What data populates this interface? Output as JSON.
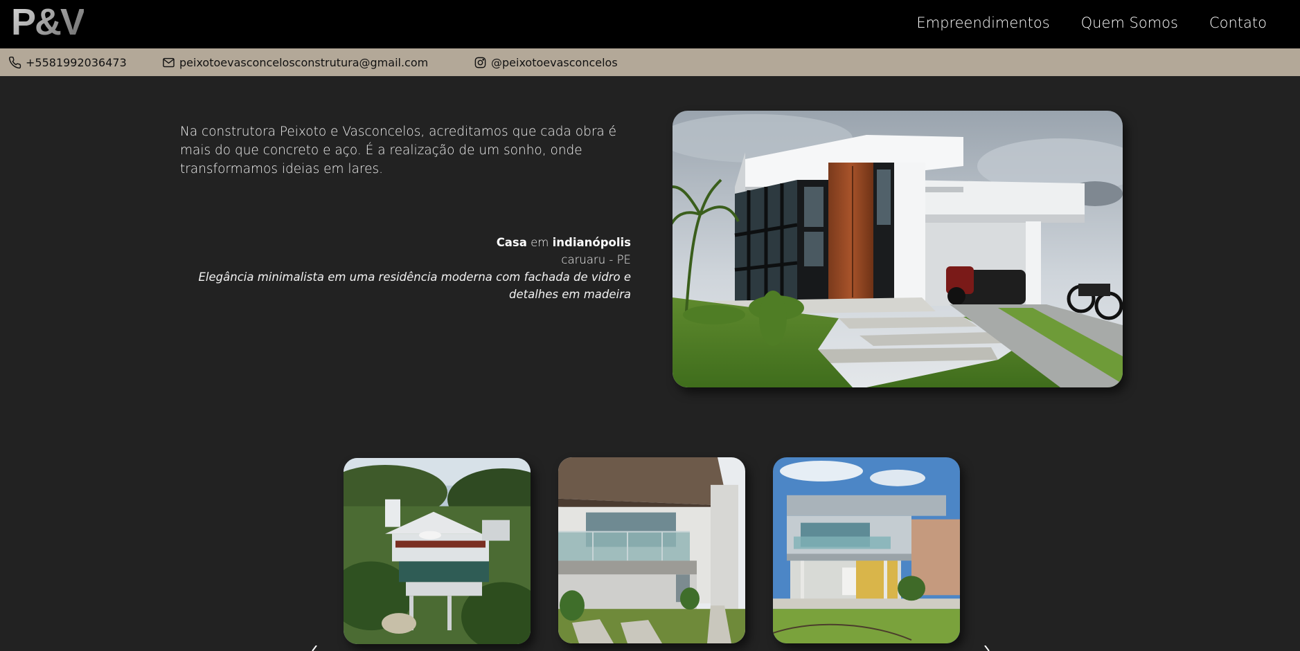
{
  "header": {
    "logo": "P&V",
    "nav": [
      "Empreendimentos",
      "Quem Somos",
      "Contato"
    ]
  },
  "contact": {
    "phone": "+5581992036473",
    "email": "peixotoevasconcelosconstrutura@gmail.com",
    "instagram": "@peixotoevasconcelos"
  },
  "hero": {
    "intro": "Na construtora Peixoto e Vasconcelos, acreditamos que cada obra é mais do que concreto e aço. É a realização de um sonho, onde transformamos ideias em lares.",
    "caption": {
      "type": "Casa",
      "connector": "em",
      "place": "indianópolis",
      "location": "caruaru - PE",
      "description": "Elegância minimalista em uma residência moderna com fachada de vidro e detalhes em madeira"
    }
  },
  "gallery": {
    "prev_icon": "chevron-left-icon",
    "next_icon": "chevron-right-icon"
  },
  "colors": {
    "header_bg": "#000000",
    "contact_bar_bg": "#b3a898",
    "page_bg": "#222222"
  }
}
